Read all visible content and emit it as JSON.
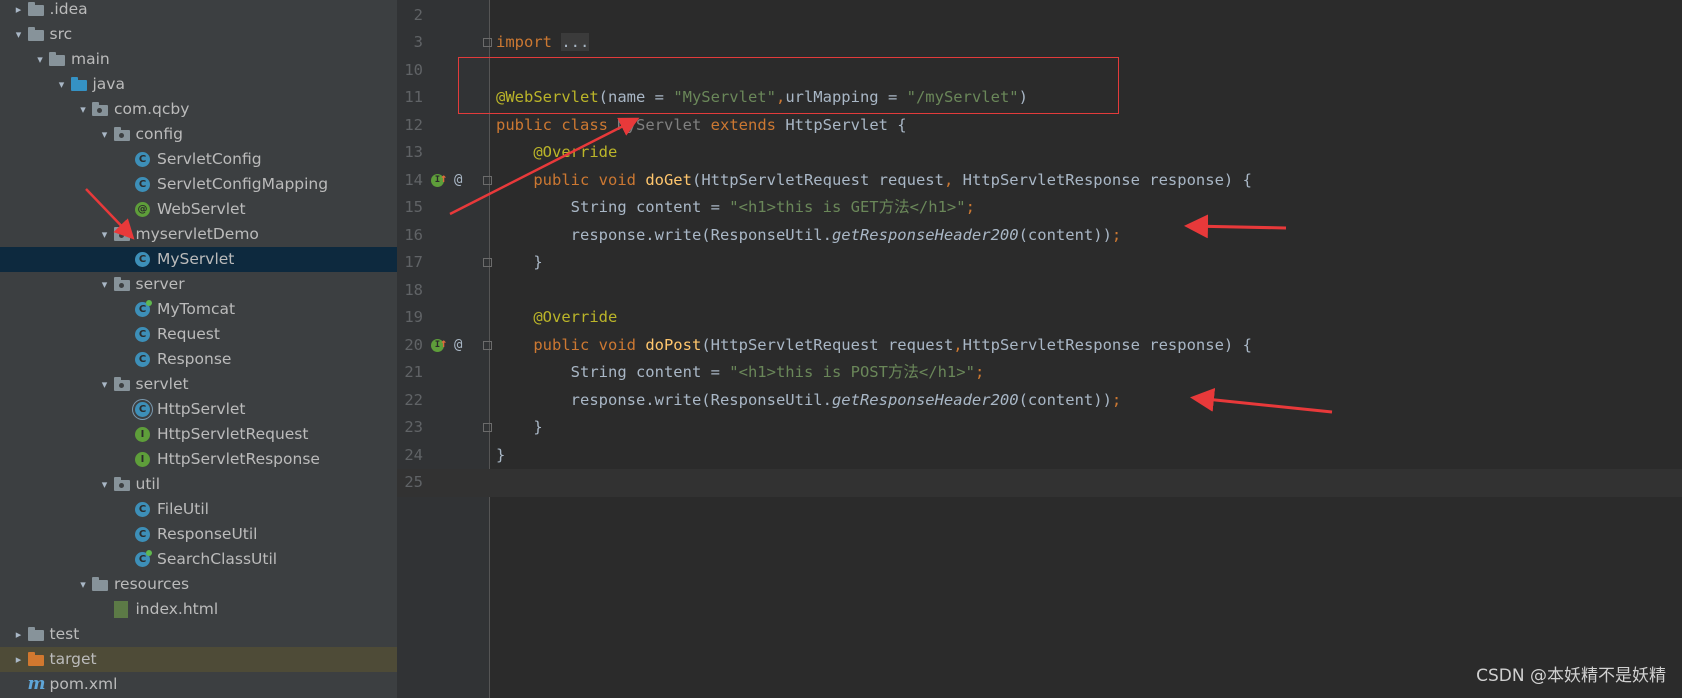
{
  "project_tree": {
    "items": [
      {
        "label": ".idea",
        "type": "folder",
        "expanded": false
      },
      {
        "label": "src",
        "type": "folder",
        "expanded": true
      },
      {
        "label": "main",
        "type": "folder",
        "expanded": true
      },
      {
        "label": "java",
        "type": "source-folder",
        "expanded": true
      },
      {
        "label": "com.qcby",
        "type": "package",
        "expanded": true
      },
      {
        "label": "config",
        "type": "package",
        "expanded": true
      },
      {
        "label": "ServletConfig",
        "type": "class"
      },
      {
        "label": "ServletConfigMapping",
        "type": "class"
      },
      {
        "label": "WebServlet",
        "type": "annotation"
      },
      {
        "label": "myservletDemo",
        "type": "package",
        "expanded": true
      },
      {
        "label": "MyServlet",
        "type": "class",
        "selected": true
      },
      {
        "label": "server",
        "type": "package",
        "expanded": true
      },
      {
        "label": "MyTomcat",
        "type": "runnable-class"
      },
      {
        "label": "Request",
        "type": "class"
      },
      {
        "label": "Response",
        "type": "class"
      },
      {
        "label": "servlet",
        "type": "package",
        "expanded": true
      },
      {
        "label": "HttpServlet",
        "type": "abstract-class"
      },
      {
        "label": "HttpServletRequest",
        "type": "interface"
      },
      {
        "label": "HttpServletResponse",
        "type": "interface"
      },
      {
        "label": "util",
        "type": "package",
        "expanded": true
      },
      {
        "label": "FileUtil",
        "type": "class"
      },
      {
        "label": "ResponseUtil",
        "type": "class"
      },
      {
        "label": "SearchClassUtil",
        "type": "runnable-class"
      },
      {
        "label": "resources",
        "type": "resources-folder",
        "expanded": true
      },
      {
        "label": "index.html",
        "type": "html-file"
      },
      {
        "label": "test",
        "type": "folder",
        "expanded": false
      },
      {
        "label": "target",
        "type": "excluded-folder",
        "expanded": false
      },
      {
        "label": "pom.xml",
        "type": "maven-file"
      }
    ]
  },
  "editor": {
    "current_line": "25",
    "lines": [
      {
        "n": "2",
        "tokens": []
      },
      {
        "n": "3",
        "tokens": [
          {
            "t": "import",
            "c": "kw"
          },
          {
            "t": " ",
            "c": ""
          },
          {
            "t": "...",
            "c": "fold-ph"
          }
        ]
      },
      {
        "n": "10",
        "tokens": []
      },
      {
        "n": "11",
        "tokens": [
          {
            "t": "@WebServlet",
            "c": "ann"
          },
          {
            "t": "(name = ",
            "c": ""
          },
          {
            "t": "\"MyServlet\"",
            "c": "str"
          },
          {
            "t": ",",
            "c": "kw"
          },
          {
            "t": "urlMapping = ",
            "c": ""
          },
          {
            "t": "\"/myServlet\"",
            "c": "str"
          },
          {
            "t": ")",
            "c": ""
          }
        ]
      },
      {
        "n": "12",
        "tokens": [
          {
            "t": "public class ",
            "c": "kw"
          },
          {
            "t": "MyServlet",
            "c": "dim"
          },
          {
            "t": " extends ",
            "c": "kw"
          },
          {
            "t": "HttpServlet {",
            "c": ""
          }
        ]
      },
      {
        "n": "13",
        "tokens": [
          {
            "t": "    ",
            "c": ""
          },
          {
            "t": "@Override",
            "c": "ann"
          }
        ]
      },
      {
        "n": "14",
        "tokens": [
          {
            "t": "    ",
            "c": ""
          },
          {
            "t": "public void ",
            "c": "kw"
          },
          {
            "t": "doGet",
            "c": "fn"
          },
          {
            "t": "(HttpServletRequest request",
            "c": ""
          },
          {
            "t": ", ",
            "c": "kw"
          },
          {
            "t": "HttpServletResponse response) {",
            "c": ""
          }
        ]
      },
      {
        "n": "15",
        "tokens": [
          {
            "t": "        String content = ",
            "c": ""
          },
          {
            "t": "\"<h1>this is GET方法</h1>\"",
            "c": "str"
          },
          {
            "t": ";",
            "c": "kw"
          }
        ]
      },
      {
        "n": "16",
        "tokens": [
          {
            "t": "        response.write(ResponseUtil.",
            "c": ""
          },
          {
            "t": "getResponseHeader200",
            "c": "it"
          },
          {
            "t": "(content))",
            "c": ""
          },
          {
            "t": ";",
            "c": "kw"
          }
        ]
      },
      {
        "n": "17",
        "tokens": [
          {
            "t": "    }",
            "c": ""
          }
        ]
      },
      {
        "n": "18",
        "tokens": []
      },
      {
        "n": "19",
        "tokens": [
          {
            "t": "    ",
            "c": ""
          },
          {
            "t": "@Override",
            "c": "ann"
          }
        ]
      },
      {
        "n": "20",
        "tokens": [
          {
            "t": "    ",
            "c": ""
          },
          {
            "t": "public void ",
            "c": "kw"
          },
          {
            "t": "doPost",
            "c": "fn"
          },
          {
            "t": "(HttpServletRequest request",
            "c": ""
          },
          {
            "t": ",",
            "c": "kw"
          },
          {
            "t": "HttpServletResponse response) {",
            "c": ""
          }
        ]
      },
      {
        "n": "21",
        "tokens": [
          {
            "t": "        String content = ",
            "c": ""
          },
          {
            "t": "\"<h1>this is POST方法</h1>\"",
            "c": "str"
          },
          {
            "t": ";",
            "c": "kw"
          }
        ]
      },
      {
        "n": "22",
        "tokens": [
          {
            "t": "        response.write(ResponseUtil.",
            "c": ""
          },
          {
            "t": "getResponseHeader200",
            "c": "it"
          },
          {
            "t": "(content))",
            "c": ""
          },
          {
            "t": ";",
            "c": "kw"
          }
        ]
      },
      {
        "n": "23",
        "tokens": [
          {
            "t": "    }",
            "c": ""
          }
        ]
      },
      {
        "n": "24",
        "tokens": [
          {
            "t": "}",
            "c": ""
          }
        ]
      },
      {
        "n": "25",
        "tokens": []
      }
    ]
  },
  "watermark": "CSDN @本妖精不是妖精",
  "colors": {
    "sidebar_bg": "#3c3f41",
    "editor_bg": "#2b2b2b",
    "selection": "#0d293e",
    "annotation_red": "#e23b3b"
  }
}
